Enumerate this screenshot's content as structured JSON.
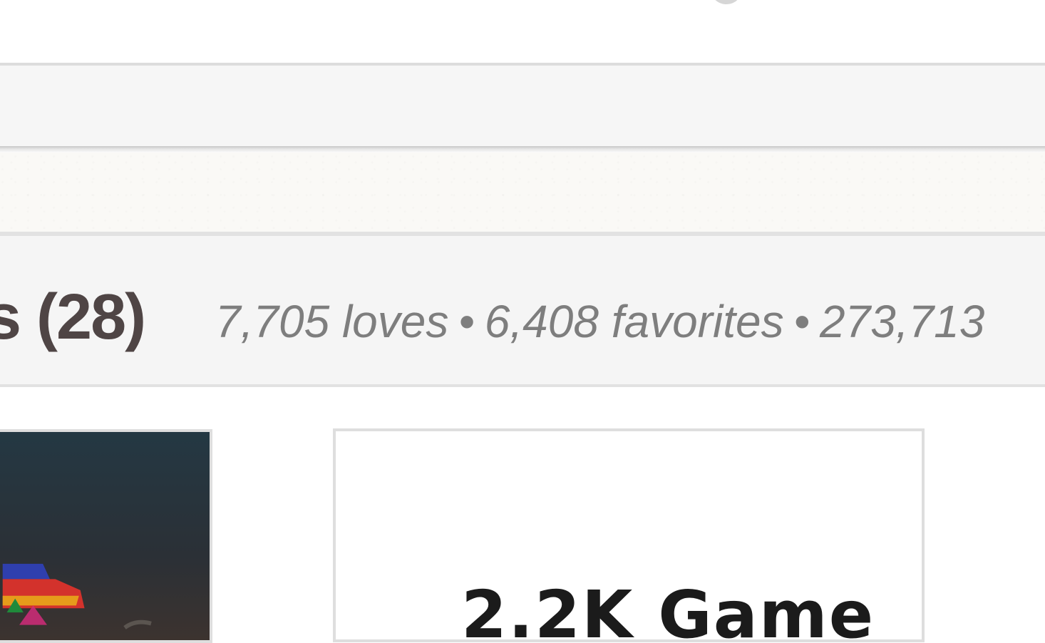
{
  "section": {
    "title": "s (28)",
    "stats": {
      "loves": "7,705 loves",
      "favorites": "6,408 favorites",
      "plays": "273,713",
      "separator": "•"
    }
  },
  "cards": [
    {
      "thumbnail_icon": "game-thumbnail-icon",
      "thumbnail_colors": [
        "#253843",
        "#2b3138",
        "#3a3230"
      ]
    },
    {
      "title": "2.2K Game"
    }
  ]
}
